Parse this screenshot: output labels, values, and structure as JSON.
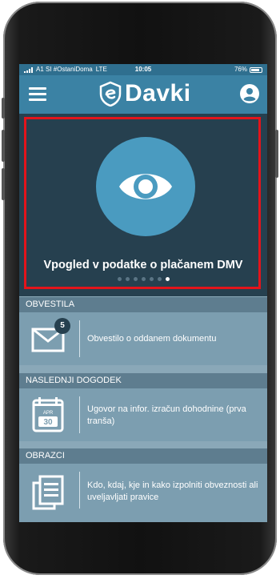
{
  "status_bar": {
    "carrier": "A1 SI #OstaniDoma",
    "network": "LTE",
    "time": "10:05",
    "battery": "76%"
  },
  "app_bar": {
    "logo_text": "Davki",
    "menu_icon": "hamburger-menu-icon",
    "account_icon": "user-account-icon"
  },
  "carousel": {
    "icon": "eye-icon",
    "title": "Vpogled v podatke o plačanem DMV",
    "page_count": 7,
    "active_index": 6,
    "highlight_color": "#e3141b"
  },
  "notifications": {
    "header": "OBVESTILA",
    "icon": "envelope-icon",
    "badge": "5",
    "text": "Obvestilo o oddanem dokumentu"
  },
  "next_event": {
    "header": "NASLEDNJI DOGODEK",
    "icon": "calendar-icon",
    "month": "APR",
    "day": "30",
    "text": "Ugovor na infor. izračun dohodnine (prva tranša)"
  },
  "forms": {
    "header": "OBRAZCI",
    "icon": "documents-icon",
    "text": "Kdo, kdaj, kje in kako izpolniti obveznosti ali uveljavljati pravice"
  },
  "colors": {
    "app_bar": "#3b82a4",
    "carousel_bg": "#26404f",
    "eye_circle": "#4a9bc0",
    "section_header": "#5e7d8f",
    "row_bg": "#7c9eb0"
  }
}
